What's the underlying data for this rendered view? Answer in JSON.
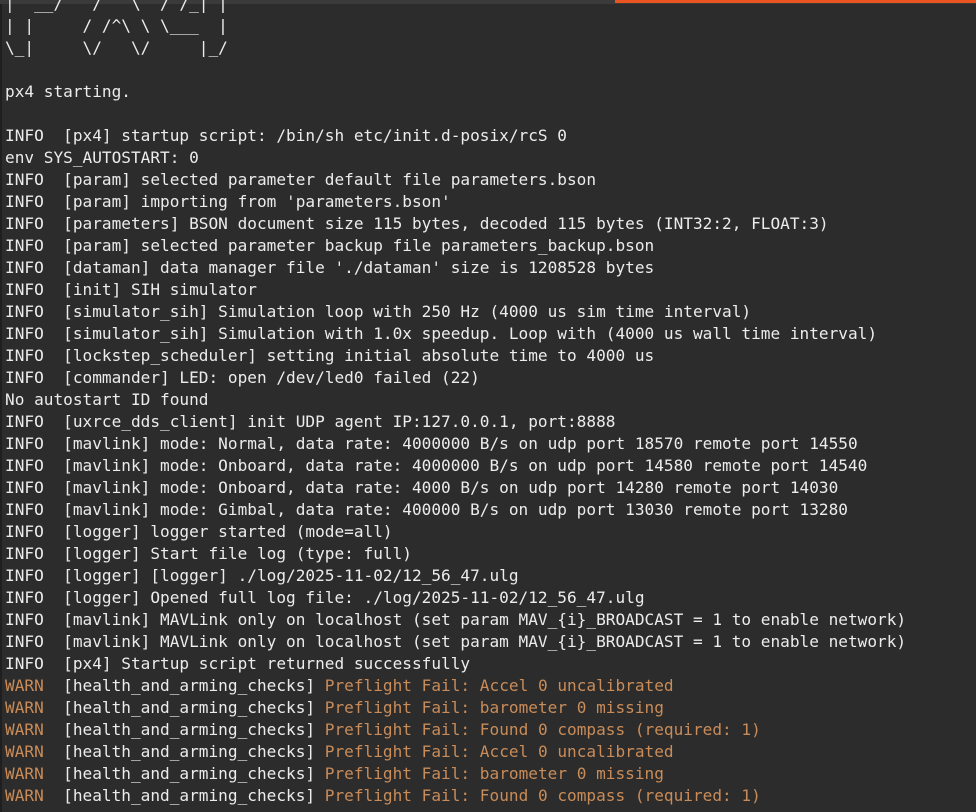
{
  "colors": {
    "background": "#2c2c2c",
    "text": "#ececec",
    "warning": "#c98c59",
    "accent": "#e95420"
  },
  "progress": {
    "fraction": 0.37
  },
  "banner": [
    "|  __/   /   \\  / /_| |",
    "| |     / /^\\ \\ \\___  |",
    "\\_|     \\/   \\/     |_/"
  ],
  "lines": [
    {
      "level": "",
      "text": ""
    },
    {
      "level": "",
      "text": "px4 starting."
    },
    {
      "level": "",
      "text": ""
    },
    {
      "level": "INFO",
      "text": "[px4] startup script: /bin/sh etc/init.d-posix/rcS 0"
    },
    {
      "level": "",
      "text": "env SYS_AUTOSTART: 0"
    },
    {
      "level": "INFO",
      "text": "[param] selected parameter default file parameters.bson"
    },
    {
      "level": "INFO",
      "text": "[param] importing from 'parameters.bson'"
    },
    {
      "level": "INFO",
      "text": "[parameters] BSON document size 115 bytes, decoded 115 bytes (INT32:2, FLOAT:3)"
    },
    {
      "level": "INFO",
      "text": "[param] selected parameter backup file parameters_backup.bson"
    },
    {
      "level": "INFO",
      "text": "[dataman] data manager file './dataman' size is 1208528 bytes"
    },
    {
      "level": "INFO",
      "text": "[init] SIH simulator"
    },
    {
      "level": "INFO",
      "text": "[simulator_sih] Simulation loop with 250 Hz (4000 us sim time interval)"
    },
    {
      "level": "INFO",
      "text": "[simulator_sih] Simulation with 1.0x speedup. Loop with (4000 us wall time interval)"
    },
    {
      "level": "INFO",
      "text": "[lockstep_scheduler] setting initial absolute time to 4000 us"
    },
    {
      "level": "INFO",
      "text": "[commander] LED: open /dev/led0 failed (22)"
    },
    {
      "level": "",
      "text": "No autostart ID found"
    },
    {
      "level": "INFO",
      "text": "[uxrce_dds_client] init UDP agent IP:127.0.0.1, port:8888"
    },
    {
      "level": "INFO",
      "text": "[mavlink] mode: Normal, data rate: 4000000 B/s on udp port 18570 remote port 14550"
    },
    {
      "level": "INFO",
      "text": "[mavlink] mode: Onboard, data rate: 4000000 B/s on udp port 14580 remote port 14540"
    },
    {
      "level": "INFO",
      "text": "[mavlink] mode: Onboard, data rate: 4000 B/s on udp port 14280 remote port 14030"
    },
    {
      "level": "INFO",
      "text": "[mavlink] mode: Gimbal, data rate: 400000 B/s on udp port 13030 remote port 13280"
    },
    {
      "level": "INFO",
      "text": "[logger] logger started (mode=all)"
    },
    {
      "level": "INFO",
      "text": "[logger] Start file log (type: full)"
    },
    {
      "level": "INFO",
      "text": "[logger] [logger] ./log/2025-11-02/12_56_47.ulg"
    },
    {
      "level": "INFO",
      "text": "[logger] Opened full log file: ./log/2025-11-02/12_56_47.ulg"
    },
    {
      "level": "INFO",
      "text": "[mavlink] MAVLink only on localhost (set param MAV_{i}_BROADCAST = 1 to enable network)"
    },
    {
      "level": "INFO",
      "text": "[mavlink] MAVLink only on localhost (set param MAV_{i}_BROADCAST = 1 to enable network)"
    },
    {
      "level": "INFO",
      "text": "[px4] Startup script returned successfully"
    },
    {
      "level": "WARN",
      "tag": "[health_and_arming_checks]",
      "text": "Preflight Fail: Accel 0 uncalibrated"
    },
    {
      "level": "WARN",
      "tag": "[health_and_arming_checks]",
      "text": "Preflight Fail: barometer 0 missing"
    },
    {
      "level": "WARN",
      "tag": "[health_and_arming_checks]",
      "text": "Preflight Fail: Found 0 compass (required: 1)"
    },
    {
      "level": "WARN",
      "tag": "[health_and_arming_checks]",
      "text": "Preflight Fail: Accel 0 uncalibrated"
    },
    {
      "level": "WARN",
      "tag": "[health_and_arming_checks]",
      "text": "Preflight Fail: barometer 0 missing"
    },
    {
      "level": "WARN",
      "tag": "[health_and_arming_checks]",
      "text": "Preflight Fail: Found 0 compass (required: 1)"
    }
  ]
}
